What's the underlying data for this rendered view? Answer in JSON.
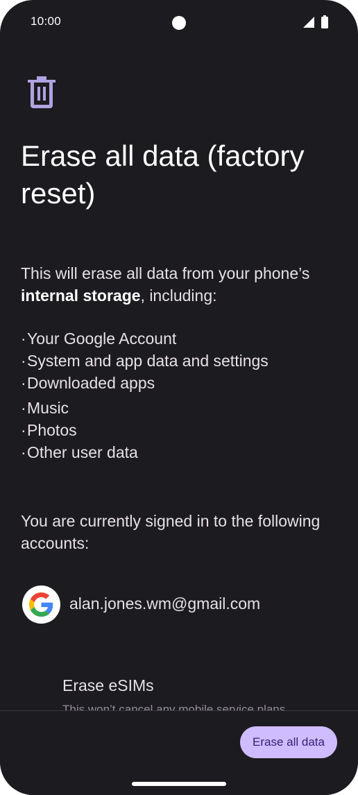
{
  "status_bar": {
    "time": "10:00",
    "icons": [
      "camera-cutout",
      "signal-icon",
      "battery-icon"
    ]
  },
  "header": {
    "icon": "trash-icon",
    "icon_color": "#b0a3e0",
    "title": "Erase all data (factory reset)"
  },
  "body": {
    "intro_prefix": "This will erase all data from your phone’s ",
    "intro_bold": "internal storage",
    "intro_suffix": ", including:",
    "bullet": "·",
    "items": [
      {
        "label": "Your Google Account"
      },
      {
        "label": "System and app data and settings"
      },
      {
        "label": "Downloaded apps"
      },
      {
        "label": "Music"
      },
      {
        "label": "Photos"
      },
      {
        "label": "Other user data"
      }
    ],
    "accounts_text": "You are currently signed in to the following accounts:",
    "account": {
      "icon": "google-logo-icon",
      "email": "alan.jones.wm@gmail.com"
    },
    "esim": {
      "title": "Erase eSIMs",
      "subtitle": "This won’t cancel any mobile service plans"
    }
  },
  "footer": {
    "erase_button": "Erase all data",
    "button_color": "#cfbcff"
  },
  "colors": {
    "background": "#1c1b1f",
    "accent": "#cfbcff"
  }
}
